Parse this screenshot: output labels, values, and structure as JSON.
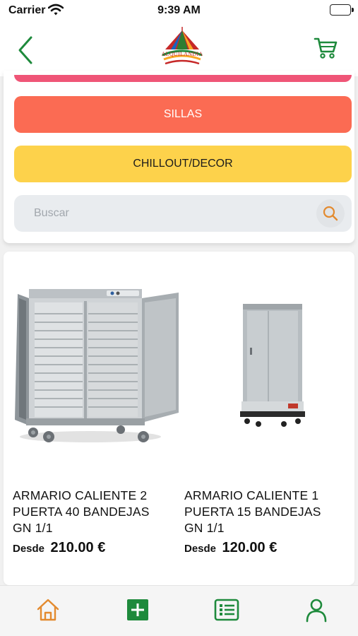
{
  "status_bar": {
    "carrier": "Carrier",
    "time": "9:39 AM"
  },
  "header": {
    "logo_text": "ALQUILANDIA",
    "brand_green": "#1e8a3c",
    "icons": [
      "back-chevron-icon",
      "shopping-cart-icon"
    ]
  },
  "filters": {
    "categories": [
      {
        "label": "SILLAS",
        "color": "#fb6b53"
      },
      {
        "label": "CHILLOUT/DECOR",
        "color": "#fdd24b"
      }
    ],
    "search": {
      "placeholder": "Buscar",
      "value": "",
      "icon": "search-icon",
      "icon_color": "#e38a2e"
    }
  },
  "products": [
    {
      "name": "ARMARIO CALIENTE 2 PUERTA 40 BANDEJAS GN 1/1",
      "price_prefix": "Desde",
      "price": "210.00 €",
      "image": "hot-cabinet-two-door-image"
    },
    {
      "name": "ARMARIO CALIENTE 1 PUERTA 15 BANDEJAS GN 1/1",
      "price_prefix": "Desde",
      "price": "120.00 €",
      "image": "hot-cabinet-one-door-image"
    }
  ],
  "tab_bar": {
    "tabs": [
      {
        "icon": "home-icon",
        "color": "#e38a2e",
        "active": true
      },
      {
        "icon": "add-icon",
        "color": "#1e8a3c",
        "active": false
      },
      {
        "icon": "list-icon",
        "color": "#1e8a3c",
        "active": false
      },
      {
        "icon": "user-icon",
        "color": "#1e8a3c",
        "active": false
      }
    ]
  }
}
